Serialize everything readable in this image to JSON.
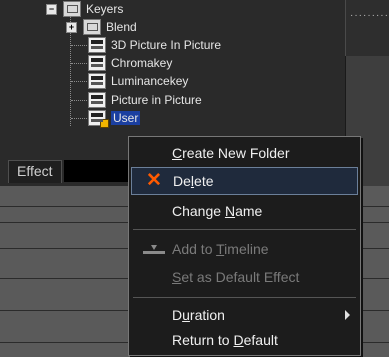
{
  "tree": {
    "root": "Keyers",
    "items": [
      {
        "label": "Blend"
      },
      {
        "label": "3D Picture In Picture"
      },
      {
        "label": "Chromakey"
      },
      {
        "label": "Luminancekey"
      },
      {
        "label": "Picture in Picture"
      },
      {
        "label": "User"
      }
    ]
  },
  "tab": {
    "label": "Effect"
  },
  "context_menu": {
    "items": [
      {
        "label": "Create New Folder",
        "enabled": true
      },
      {
        "label": "Delete",
        "enabled": true,
        "highlighted": true,
        "icon": "x-icon"
      },
      {
        "label": "Change Name",
        "enabled": true
      },
      {
        "label": "Add to Timeline",
        "enabled": false,
        "icon": "add-to-timeline-icon"
      },
      {
        "label": "Set as Default Effect",
        "enabled": false
      },
      {
        "label": "Duration",
        "enabled": true,
        "submenu": true
      },
      {
        "label": "Return to Default",
        "enabled": true
      }
    ]
  },
  "colors": {
    "delete_icon": "#ff5a00",
    "selection": "#1b3fa0",
    "menu_highlight": "#1f2a3c"
  }
}
